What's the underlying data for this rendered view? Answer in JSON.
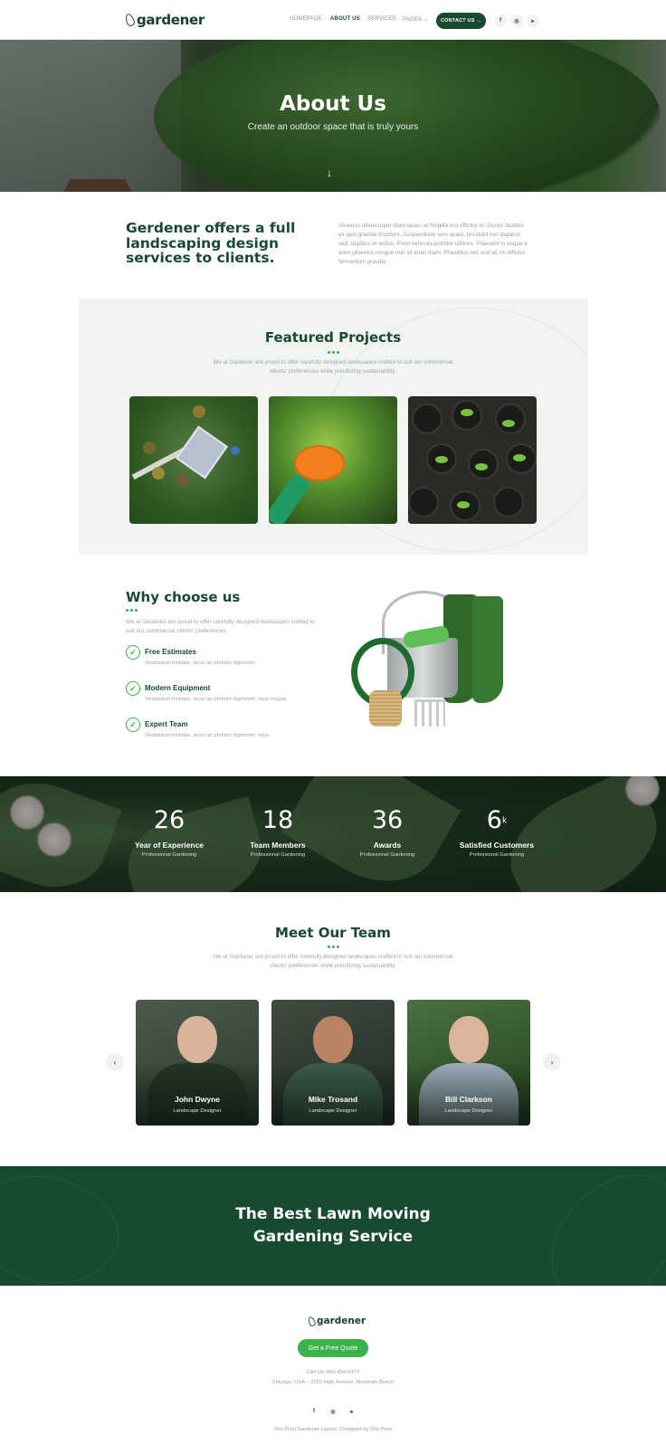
{
  "header": {
    "logo": "gardener",
    "nav": [
      "HOMEPAGE",
      "ABOUT US",
      "SERVICES",
      "PAGES ⌄"
    ],
    "contact": "CONTACT US →",
    "social": [
      "f",
      "◎",
      "▸"
    ]
  },
  "hero": {
    "title": "About Us",
    "subtitle": "Create an outdoor space that is truly yours",
    "arrow": "↓"
  },
  "intro": {
    "title": "Gerdener offers a full landscaping design services to clients.",
    "text": "Vivamus ullamcorper diam lacus, at fringilla nisi efficitur et. Donec facilisis ex quis gravida tincidunt. Suspendisse sem quam, tincidunt nec dapibus sed, dapibus et lectus. Proin vehicula porttitor ultrices. Praesent in neque a enim pharetra congue non sit amet diam. Phasellus nec erat ac mi efficitur fermentum gravida."
  },
  "featured": {
    "title": "Featured Projects",
    "subtitle": "We at Gardener are proud to offer carefully designed landscapes crafted to suit our commercial clients' preferences while prioritizing sustainability."
  },
  "why": {
    "title": "Why choose us",
    "subtitle": "We at Gardener are proud to offer carefully designed landscapes crafted to suit our commercial clients' preferences.",
    "features": [
      {
        "title": "Free Estimates",
        "desc": "Vestibulum tristique, lacus ac pretium dignissim."
      },
      {
        "title": "Modern Equipment",
        "desc": "Vestibulum tristique, lacus ac pretium dignissim, risus magna."
      },
      {
        "title": "Expert Team",
        "desc": "Vestibulum tristique, lacus ac pretium dignissim, risus."
      }
    ]
  },
  "stats": [
    {
      "num": "26",
      "suffix": "",
      "label": "Year of Experience",
      "sub": "Professional Gardening"
    },
    {
      "num": "18",
      "suffix": "",
      "label": "Team Members",
      "sub": "Professional Gardening"
    },
    {
      "num": "36",
      "suffix": "",
      "label": "Awards",
      "sub": "Professional Gardening"
    },
    {
      "num": "6",
      "suffix": "k",
      "label": "Satisfied Customers",
      "sub": "Professional Gardening"
    }
  ],
  "team": {
    "title": "Meet Our Team",
    "subtitle": "We at Gardener are proud to offer carefully designed landscapes crafted to suit our commercial clients' preferences while prioritizing sustainability.",
    "members": [
      {
        "name": "John Dwyne",
        "role": "Landscape Designer"
      },
      {
        "name": "Mike Trosand",
        "role": "Landscape Designer"
      },
      {
        "name": "Bill Clarkson",
        "role": "Landscape Designer"
      }
    ],
    "prev": "‹",
    "next": "›"
  },
  "cta": {
    "line1": "The Best Lawn Moving",
    "line2": "Gardening Service"
  },
  "footer": {
    "logo": "gardener",
    "button": "Get a Free Quote",
    "phone": "Call Us: 800-454-9272",
    "address": "Chicago, USA – 2120 High Avenue, Mountain Beach",
    "social": [
      "f",
      "◎",
      "▸"
    ],
    "credit": "Divi Pixel Gardener Layout. Designed by Divi Pixel"
  },
  "colors": {
    "primary": "#174a2f",
    "accent": "#3ab34a"
  }
}
